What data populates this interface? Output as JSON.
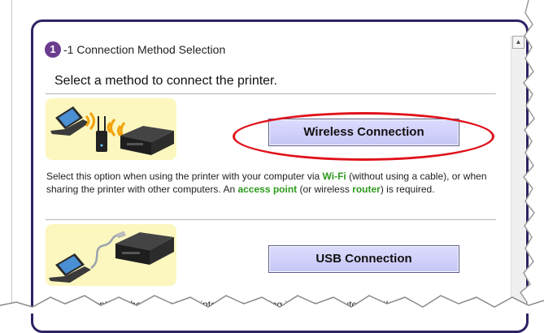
{
  "step": {
    "number": "1",
    "title": "-1 Connection Method Selection"
  },
  "subtitle": "Select a method to connect the printer.",
  "options": {
    "wireless": {
      "button_label": "Wireless Connection",
      "desc_1": "Select this option when using the printer with your computer via ",
      "kw_wifi": "Wi-Fi",
      "desc_2": " (without using a cable), or when sharing the printer with other computers. An ",
      "kw_ap": "access point",
      "desc_3": " (or wireless ",
      "kw_router": "router",
      "desc_4": ") is required."
    },
    "usb": {
      "button_label": "USB Connection",
      "desc_partial": "Select this option when using the printer by connecting it to the computer with the"
    }
  },
  "scrollbar": {
    "up_arrow": "▲"
  },
  "colors": {
    "panel_border": "#2c2463",
    "step_badge": "#6a3d8f",
    "keyword_green": "#2c9a1c",
    "highlight_oval": "#e0121b",
    "button_fill": "#c6c6f5",
    "illustration_bg": "#fbf7bf"
  },
  "icons": {
    "wireless_illustration": [
      "laptop-icon",
      "wifi-waves-icon",
      "router-icon",
      "printer-icon"
    ],
    "usb_illustration": [
      "laptop-icon",
      "usb-cable-icon",
      "printer-icon"
    ]
  }
}
